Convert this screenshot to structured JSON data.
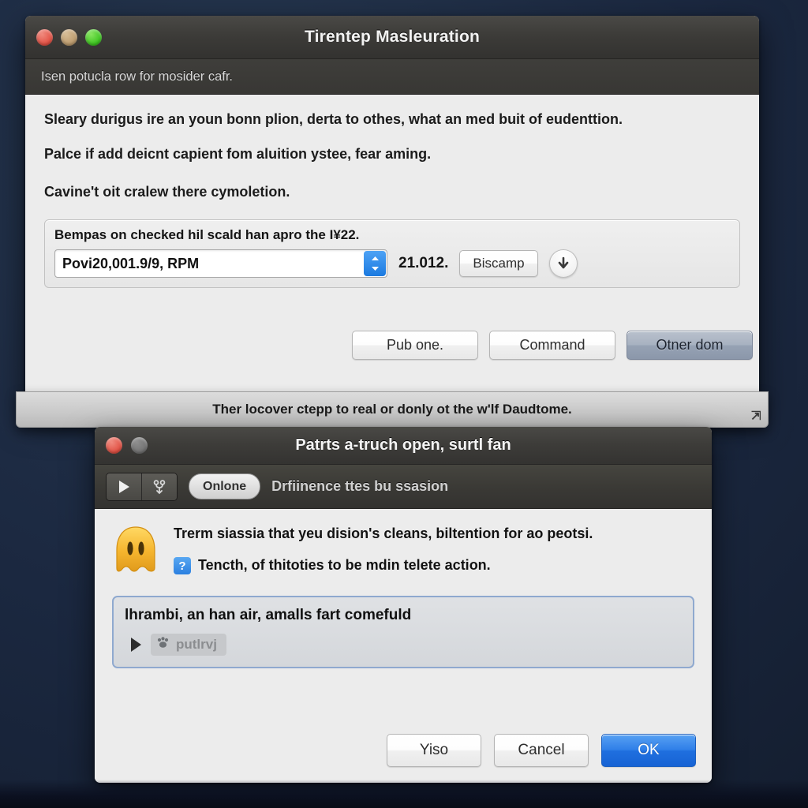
{
  "desktop": {
    "background_color": "#1d2b42"
  },
  "window1": {
    "title": "Tirentep Masleuration",
    "traffic_lights": [
      {
        "name": "close",
        "color": "#e04e41"
      },
      {
        "name": "minimize",
        "color": "#bb9a6c"
      },
      {
        "name": "zoom",
        "color": "#39c21d"
      }
    ],
    "subbar_text": "Isen potucla row for mosider cafr.",
    "paragraphs": [
      "Sleary durigus ire an youn bonn plion, derta to othes, what an med buit of eudenttion.",
      "Palce if add deicnt capient fom aluition ystee, fear aming.",
      "Cavine't oit cralew there cymoletion."
    ],
    "fieldbox": {
      "label": "Bempas on checked hil scald han apro the I¥22.",
      "popup_value": "Povi20,001.9/9, RPM",
      "stepper_icon": "up-down-chevrons-icon",
      "inline_value": "21.012.",
      "action_button": "Biscamp",
      "download_icon": "down-arrow-icon"
    },
    "buttons": [
      {
        "label": "Pub one.",
        "style": "normal"
      },
      {
        "label": "Command",
        "style": "normal"
      },
      {
        "label": "Otner dom",
        "style": "selected"
      }
    ],
    "statusbar": {
      "text": "Ther locover ctepp to real or donly ot the w'lf Daudtome.",
      "grip_icon": "resize-grip-icon"
    }
  },
  "window2": {
    "title": "Patrts a-truch open, surtl fan",
    "traffic_lights": [
      {
        "name": "close",
        "color": "#e04e41"
      },
      {
        "name": "minimize-disabled",
        "color": "#727272"
      }
    ],
    "toolbar": {
      "segment_icons": [
        "play-icon",
        "branch-icon"
      ],
      "pill_label": "Onlone",
      "label": "Drfiinence ttes bu ssasion"
    },
    "warning": {
      "icon": "warning-ghost-icon",
      "text": "Trerm siassia that yeu dision's cleans, biltention for ao peotsi.",
      "help_badge": "?",
      "help_text": "Tencth, of thitoties to be mdin telete action."
    },
    "disclosure": {
      "title": "lhrambi, an han air, amalls fart comefuld",
      "triangle_icon": "disclosure-triangle-icon",
      "chip_icon": "paw-icon",
      "chip_label": "putlrvj"
    },
    "buttons": [
      {
        "label": "Yiso",
        "style": "normal"
      },
      {
        "label": "Cancel",
        "style": "normal"
      },
      {
        "label": "OK",
        "style": "primary",
        "color": "#2f7fe8"
      }
    ]
  }
}
